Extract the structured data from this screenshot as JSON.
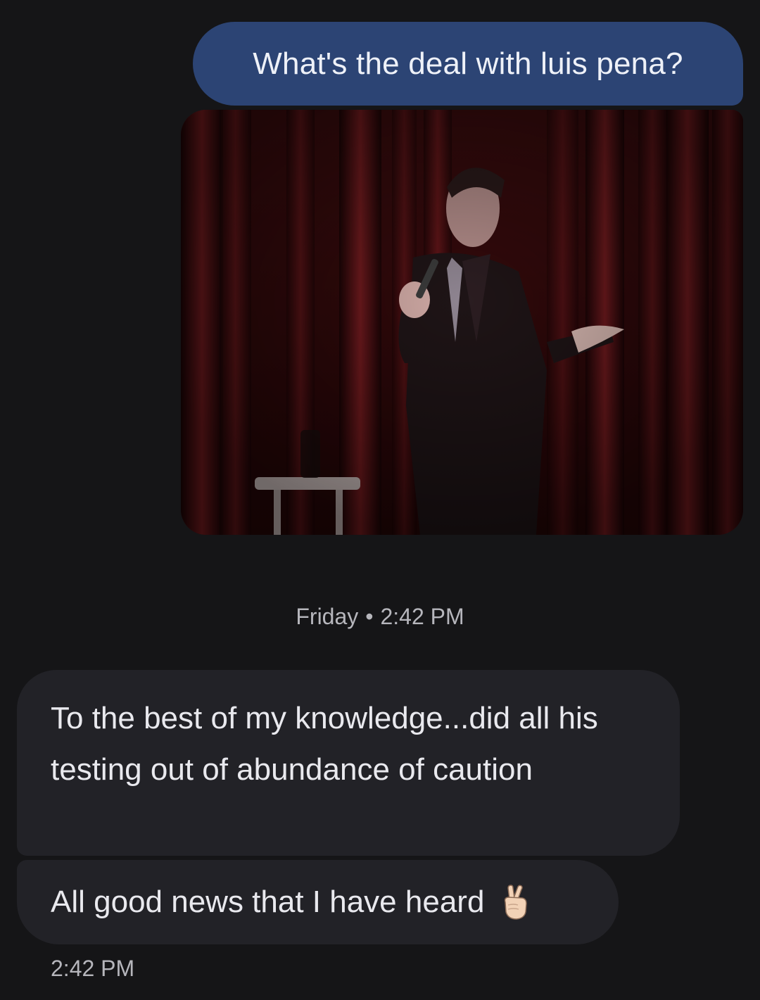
{
  "messages": {
    "outgoing_text": "What's the deal with luis pena?",
    "gif_description_icon": "gif-stand-up-comedian",
    "divider": {
      "day": "Friday",
      "separator": "•",
      "time": "2:42 PM"
    },
    "incoming": [
      {
        "text": "To the best of my knowledge...did all his testing out of abundance of caution"
      },
      {
        "text": "All good news that I have heard",
        "emoji_icon": "crossed-fingers-icon"
      }
    ],
    "incoming_time": "2:42 PM"
  },
  "colors": {
    "background": "#151517",
    "outgoing_bubble": "#2c4474",
    "incoming_bubble": "#222227",
    "meta_text": "#b6b6bc"
  }
}
